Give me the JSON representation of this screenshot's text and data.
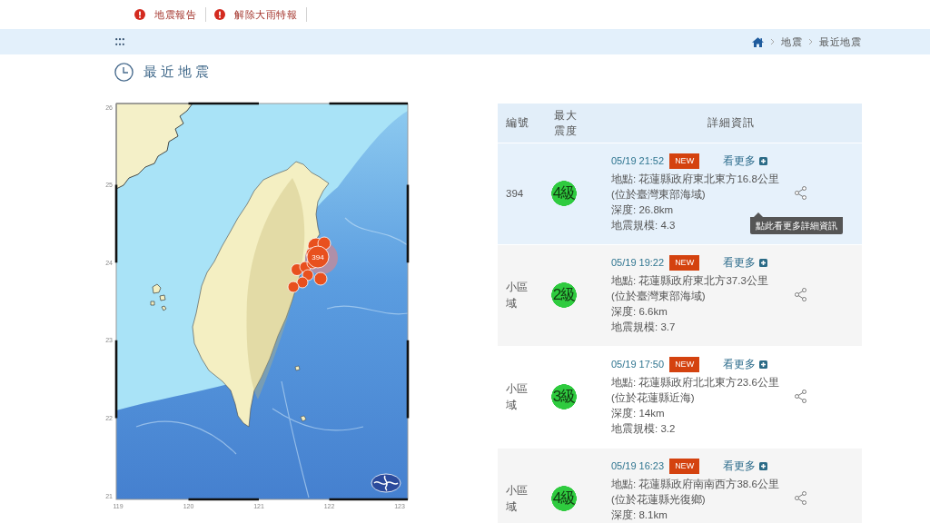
{
  "alerts": [
    {
      "label": "地震報告"
    },
    {
      "label": "解除大雨特報"
    }
  ],
  "breadcrumb": [
    {
      "label": "地震"
    },
    {
      "label": "最近地震"
    }
  ],
  "page_title": "最近地震",
  "map": {
    "yticks": [
      "26",
      "25",
      "24",
      "23",
      "22",
      "21"
    ],
    "xticks": [
      "119",
      "120",
      "121",
      "122",
      "123"
    ],
    "marker_label": "394"
  },
  "table": {
    "columns": [
      "編號",
      "最大震度",
      "詳細資訊"
    ],
    "rows": [
      {
        "number": "394",
        "intensity": "4級",
        "time": "05/19 21:52",
        "badge": "NEW",
        "more": "看更多",
        "location": "地點: 花蓮縣政府東北東方16.8公里",
        "area": "(位於臺灣東部海域)",
        "depth": "深度: 26.8km",
        "magnitude": "地震規模: 4.3",
        "tooltip": "點此看更多詳細資訊",
        "selected": true
      },
      {
        "number": "小區域",
        "intensity": "2級",
        "time": "05/19 19:22",
        "badge": "NEW",
        "more": "看更多",
        "location": "地點: 花蓮縣政府東北方37.3公里",
        "area": "(位於臺灣東部海域)",
        "depth": "深度: 6.6km",
        "magnitude": "地震規模: 3.7",
        "selected": false
      },
      {
        "number": "小區域",
        "intensity": "3級",
        "time": "05/19 17:50",
        "badge": "NEW",
        "more": "看更多",
        "location": "地點: 花蓮縣政府北北東方23.6公里",
        "area": "(位於花蓮縣近海)",
        "depth": "深度: 14km",
        "magnitude": "地震規模: 3.2",
        "selected": false
      },
      {
        "number": "小區域",
        "intensity": "4級",
        "time": "05/19 16:23",
        "badge": "NEW",
        "more": "看更多",
        "location": "地點: 花蓮縣政府南南西方38.6公里",
        "area": "(位於花蓮縣光復鄉)",
        "depth": "深度: 8.1km",
        "selected": false
      }
    ]
  }
}
